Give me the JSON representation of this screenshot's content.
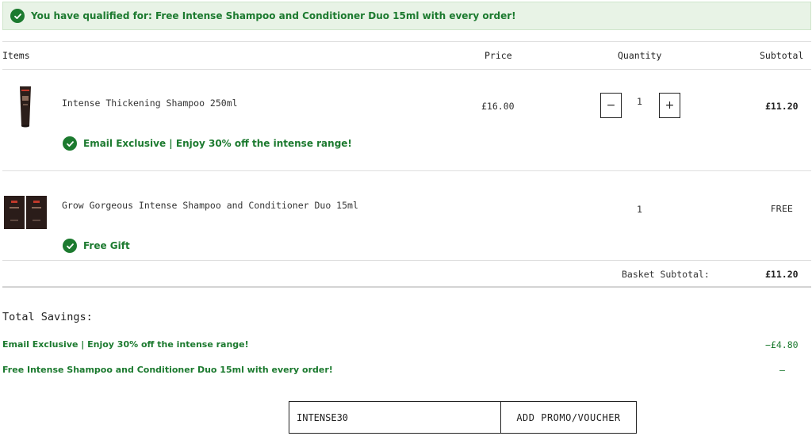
{
  "banner": {
    "icon": "check-circle-icon",
    "text": "You have qualified for: Free Intense Shampoo and Conditioner Duo 15ml with every order!"
  },
  "table": {
    "headers": {
      "items": "Items",
      "price": "Price",
      "quantity": "Quantity",
      "subtotal": "Subtotal"
    }
  },
  "items": [
    {
      "name": "Intense Thickening Shampoo 250ml",
      "price": "£16.00",
      "quantity": "1",
      "subtotal": "£11.20",
      "promo": "Email Exclusive | Enjoy 30% off the intense range!",
      "decrease_label": "−",
      "increase_label": "+"
    },
    {
      "name": "Grow Gorgeous Intense Shampoo and Conditioner Duo 15ml",
      "quantity": "1",
      "subtotal": "FREE",
      "promo": "Free Gift"
    }
  ],
  "basket": {
    "label": "Basket Subtotal:",
    "value": "£11.20"
  },
  "savings": {
    "title": "Total Savings:",
    "rows": [
      {
        "label": "Email Exclusive | Enjoy 30% off the intense range!",
        "value": "−£4.80"
      },
      {
        "label": "Free Intense Shampoo and Conditioner Duo 15ml with every order!",
        "value": "–"
      }
    ]
  },
  "voucher": {
    "value": "INTENSE30",
    "button_label": "ADD PROMO/VOUCHER"
  },
  "colors": {
    "accent_green": "#1c7a2f",
    "banner_bg": "#e8f3e6",
    "border": "#222222"
  }
}
